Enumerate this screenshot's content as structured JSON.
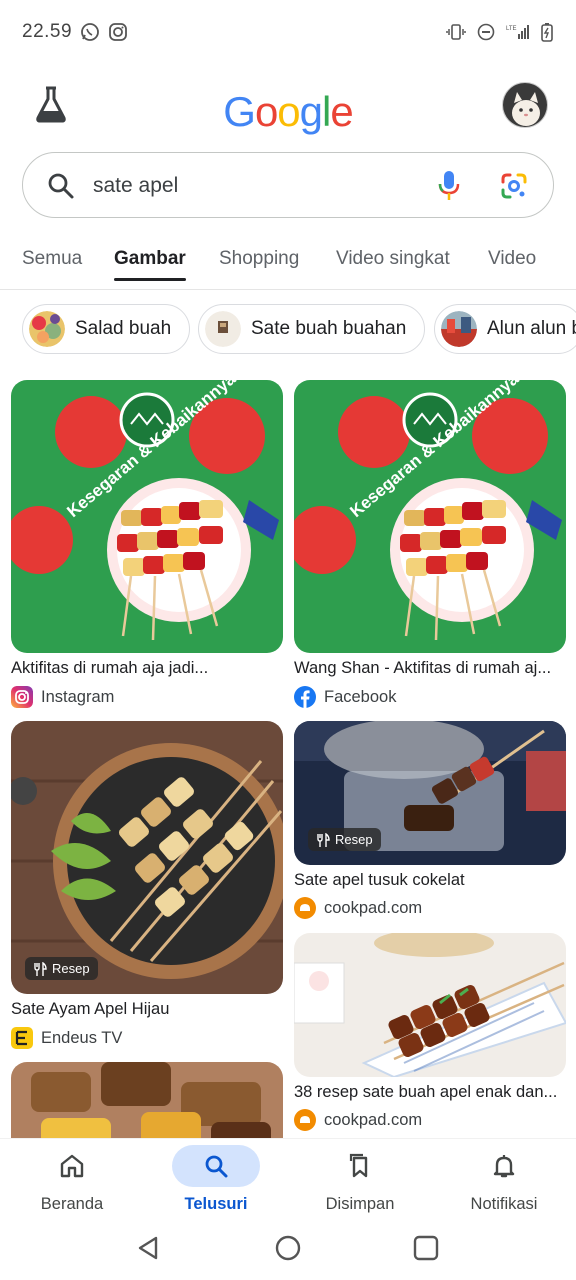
{
  "status_bar": {
    "time": "22.59",
    "left_icons": [
      "whatsapp-icon",
      "instagram-icon"
    ],
    "right_icons": [
      "vibrate-icon",
      "dnd-icon",
      "lte-signal-icon",
      "battery-icon"
    ]
  },
  "header": {
    "logo": "Google",
    "labs_icon": "flask-icon",
    "avatar": "avatar"
  },
  "search": {
    "query": "sate apel"
  },
  "tabs": [
    {
      "label": "Semua"
    },
    {
      "label": "Gambar"
    },
    {
      "label": "Shopping"
    },
    {
      "label": "Video singkat"
    },
    {
      "label": "Video"
    }
  ],
  "active_tab": "Gambar",
  "chips": [
    {
      "label": "Salad buah"
    },
    {
      "label": "Sate buah buahan"
    },
    {
      "label": "Alun alun b"
    }
  ],
  "results": [
    {
      "title": "Aktifitas di rumah aja jadi...",
      "source": "Instagram",
      "source_icon": "instagram-icon"
    },
    {
      "title": "Wang Shan - Aktifitas di rumah aj...",
      "source": "Facebook",
      "source_icon": "facebook-icon"
    },
    {
      "title": "Sate Ayam Apel Hijau",
      "source": "Endeus TV",
      "source_icon": "endeus-icon",
      "badge": "Resep"
    },
    {
      "title": "Sate apel tusuk cokelat",
      "source": "cookpad.com",
      "source_icon": "cookpad-icon",
      "badge": "Resep"
    },
    {
      "title": "38 resep sate buah apel enak dan...",
      "source": "cookpad.com",
      "source_icon": "cookpad-icon"
    }
  ],
  "bottom_nav": [
    {
      "label": "Beranda",
      "icon": "home-icon"
    },
    {
      "label": "Telusuri",
      "icon": "search-icon"
    },
    {
      "label": "Disimpan",
      "icon": "bookmark-icon"
    },
    {
      "label": "Notifikasi",
      "icon": "bell-icon"
    }
  ],
  "active_nav": "Telusuri",
  "colors": {
    "google_blue": "#4285F4",
    "google_red": "#EA4335",
    "google_yellow": "#FBBC05",
    "google_green": "#34A853",
    "active_nav": "#0b57d0",
    "active_pill": "#d3e3fd"
  }
}
